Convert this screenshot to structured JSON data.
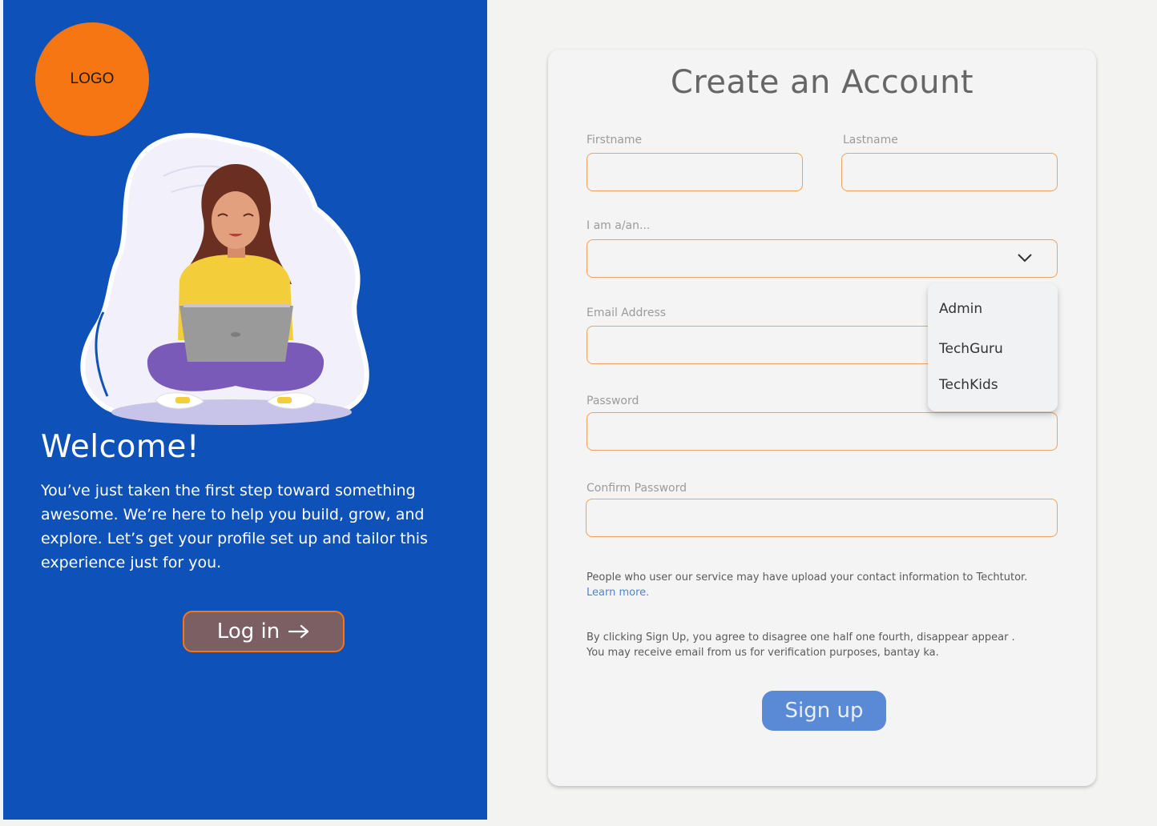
{
  "brand": {
    "logo_text": "LOGO"
  },
  "welcome": {
    "title": "Welcome!",
    "text": "You’ve just taken the first step toward something awesome. We’re here to help you build, grow, and explore. Let’s get your profile set up and tailor this experience just for you.",
    "login_label": "Log in"
  },
  "form": {
    "title": "Create an Account",
    "firstname_label": "Firstname",
    "lastname_label": "Lastname",
    "role_label": "I am a/an...",
    "role_options": [
      "Admin",
      "TechGuru",
      "TechKids"
    ],
    "email_label": "Email Address",
    "password_label": "Password",
    "confirm_label": "Confirm Password",
    "contact_notice": "People who  user our  service may have upload your contact information to Techtutor.",
    "learn_more": "Learn more.",
    "terms_text": "By clicking Sign Up, you agree to disagree one half one fourth, disappear appear . You may receive email from us for verification purposes, bantay ka.",
    "signup_label": "Sign up"
  },
  "colors": {
    "left_panel_bg": "#0e52b9",
    "logo_bg": "#f57613",
    "input_border": "#f0a15a",
    "signup_bg": "#5a8ad6",
    "login_bg": "#7c5f63",
    "link": "#4f84d4"
  },
  "icons": [
    "chevron-down-icon",
    "arrow-right-icon",
    "person-laptop-illustration"
  ]
}
